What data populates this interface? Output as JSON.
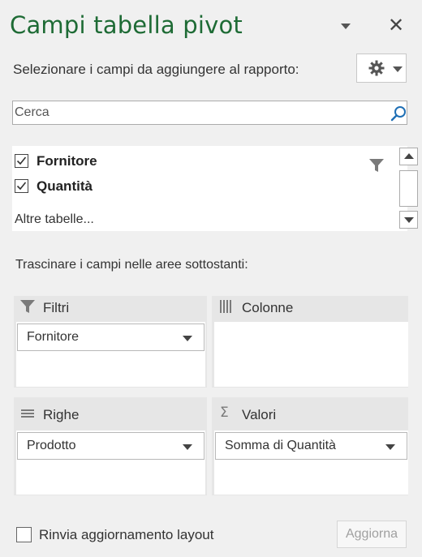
{
  "pane": {
    "title": "Campi tabella pivot",
    "choose_fields_label": "Selezionare i campi da aggiungere al rapporto:",
    "search_placeholder": "Cerca",
    "fields": [
      {
        "label": "Fornitore",
        "checked": true,
        "filtered": true
      },
      {
        "label": "Quantità",
        "checked": true,
        "filtered": false
      }
    ],
    "more_tables": "Altre tabelle...",
    "drag_hint": "Trascinare i campi nelle aree sottostanti:"
  },
  "areas": {
    "filters": {
      "title": "Filtri",
      "items": [
        "Fornitore"
      ]
    },
    "columns": {
      "title": "Colonne",
      "items": []
    },
    "rows": {
      "title": "Righe",
      "items": [
        "Prodotto"
      ]
    },
    "values": {
      "title": "Valori",
      "items": [
        "Somma di Quantità"
      ]
    }
  },
  "footer": {
    "defer_label": "Rinvia aggiornamento layout",
    "defer_checked": false,
    "update_label": "Aggiorna"
  },
  "icons": {
    "gear": "gear-icon",
    "search": "search-icon",
    "filter": "filter-icon",
    "close": "close-icon",
    "sigma": "sigma-icon"
  },
  "colors": {
    "title": "#1e6b35",
    "pane_bg": "#f0f0f0",
    "area_bg": "#e6e6e6",
    "search_icon": "#1f6fb5"
  }
}
